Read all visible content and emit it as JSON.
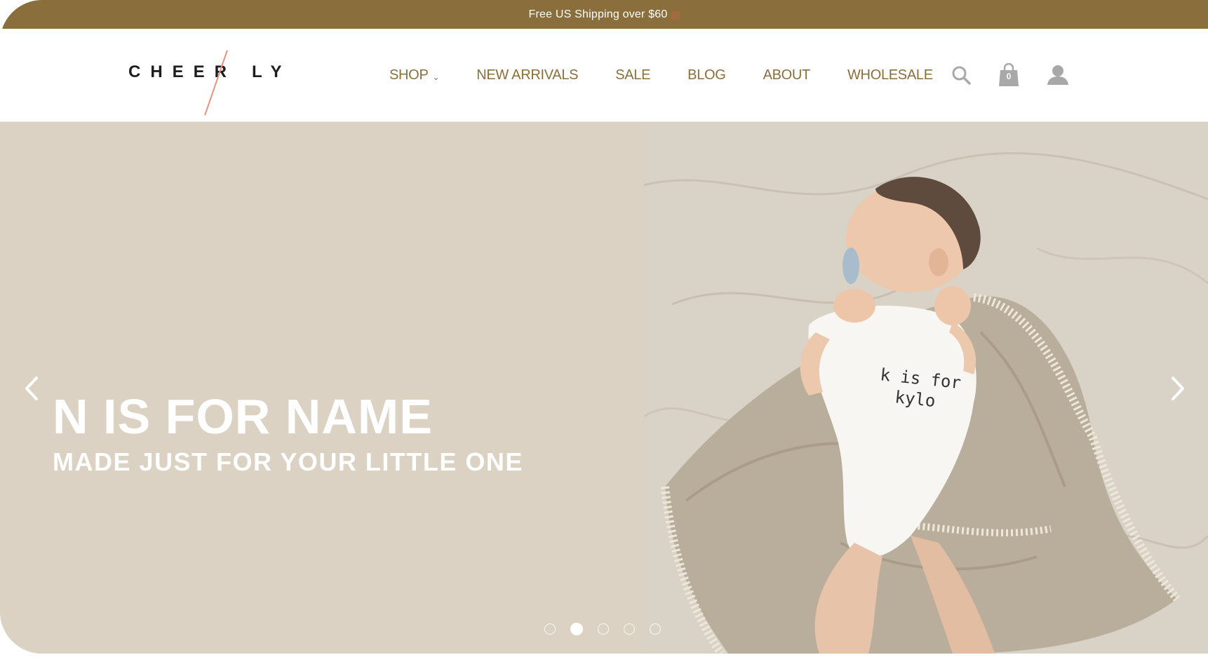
{
  "announcement": {
    "text": "Free US Shipping over $60"
  },
  "brand": {
    "logo_text": "CHEER/LY",
    "logo_letters_left": "CHEER",
    "logo_letters_right": "LY"
  },
  "nav": {
    "items": [
      {
        "label": "SHOP",
        "has_dropdown": true
      },
      {
        "label": "NEW ARRIVALS"
      },
      {
        "label": "SALE"
      },
      {
        "label": "BLOG"
      },
      {
        "label": "ABOUT"
      },
      {
        "label": "WHOLESALE"
      }
    ]
  },
  "header_icons": {
    "search": "search-icon",
    "cart": "shopping-bag-icon",
    "cart_count": "0",
    "account": "user-icon"
  },
  "hero": {
    "title": "N IS FOR NAME",
    "subtitle": "MADE JUST FOR YOUR LITTLE ONE",
    "onesie_text_line1": "k is for",
    "onesie_text_line2": "kylo",
    "slide_count": 5,
    "active_slide": 2
  },
  "colors": {
    "accent": "#8a6f3c",
    "hero_bg": "#dbd2c3",
    "logo_slash": "#e9917c",
    "icon_grey": "#a8a8a8"
  }
}
